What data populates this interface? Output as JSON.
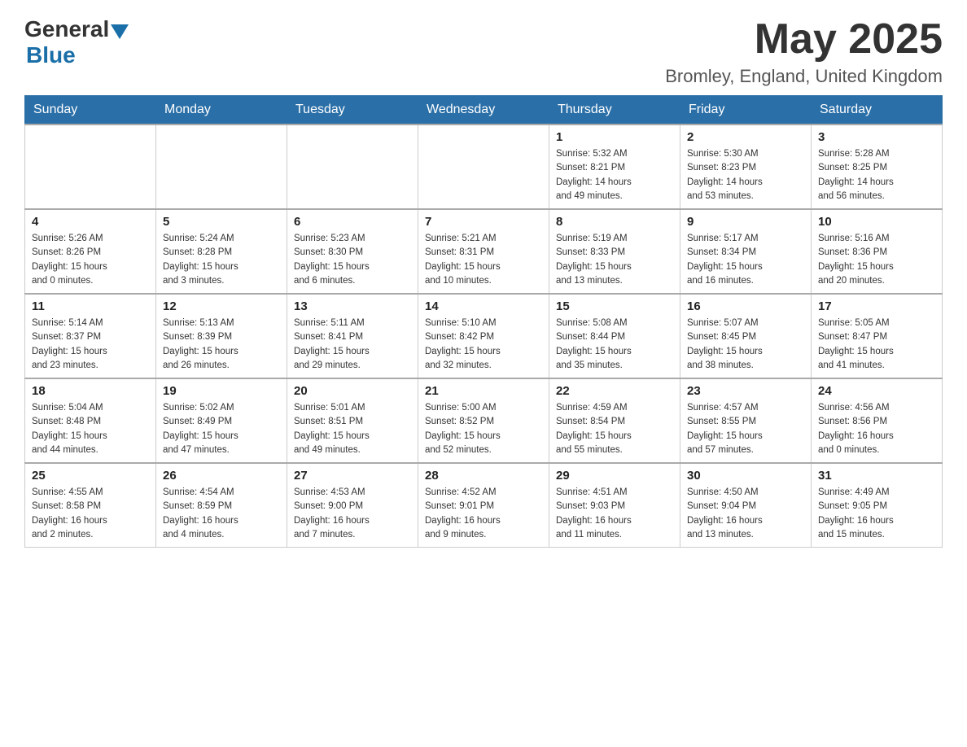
{
  "header": {
    "logo_general": "General",
    "logo_blue": "Blue",
    "month_title": "May 2025",
    "location": "Bromley, England, United Kingdom"
  },
  "days_of_week": [
    "Sunday",
    "Monday",
    "Tuesday",
    "Wednesday",
    "Thursday",
    "Friday",
    "Saturday"
  ],
  "weeks": [
    {
      "days": [
        {
          "number": "",
          "info": ""
        },
        {
          "number": "",
          "info": ""
        },
        {
          "number": "",
          "info": ""
        },
        {
          "number": "",
          "info": ""
        },
        {
          "number": "1",
          "info": "Sunrise: 5:32 AM\nSunset: 8:21 PM\nDaylight: 14 hours\nand 49 minutes."
        },
        {
          "number": "2",
          "info": "Sunrise: 5:30 AM\nSunset: 8:23 PM\nDaylight: 14 hours\nand 53 minutes."
        },
        {
          "number": "3",
          "info": "Sunrise: 5:28 AM\nSunset: 8:25 PM\nDaylight: 14 hours\nand 56 minutes."
        }
      ]
    },
    {
      "days": [
        {
          "number": "4",
          "info": "Sunrise: 5:26 AM\nSunset: 8:26 PM\nDaylight: 15 hours\nand 0 minutes."
        },
        {
          "number": "5",
          "info": "Sunrise: 5:24 AM\nSunset: 8:28 PM\nDaylight: 15 hours\nand 3 minutes."
        },
        {
          "number": "6",
          "info": "Sunrise: 5:23 AM\nSunset: 8:30 PM\nDaylight: 15 hours\nand 6 minutes."
        },
        {
          "number": "7",
          "info": "Sunrise: 5:21 AM\nSunset: 8:31 PM\nDaylight: 15 hours\nand 10 minutes."
        },
        {
          "number": "8",
          "info": "Sunrise: 5:19 AM\nSunset: 8:33 PM\nDaylight: 15 hours\nand 13 minutes."
        },
        {
          "number": "9",
          "info": "Sunrise: 5:17 AM\nSunset: 8:34 PM\nDaylight: 15 hours\nand 16 minutes."
        },
        {
          "number": "10",
          "info": "Sunrise: 5:16 AM\nSunset: 8:36 PM\nDaylight: 15 hours\nand 20 minutes."
        }
      ]
    },
    {
      "days": [
        {
          "number": "11",
          "info": "Sunrise: 5:14 AM\nSunset: 8:37 PM\nDaylight: 15 hours\nand 23 minutes."
        },
        {
          "number": "12",
          "info": "Sunrise: 5:13 AM\nSunset: 8:39 PM\nDaylight: 15 hours\nand 26 minutes."
        },
        {
          "number": "13",
          "info": "Sunrise: 5:11 AM\nSunset: 8:41 PM\nDaylight: 15 hours\nand 29 minutes."
        },
        {
          "number": "14",
          "info": "Sunrise: 5:10 AM\nSunset: 8:42 PM\nDaylight: 15 hours\nand 32 minutes."
        },
        {
          "number": "15",
          "info": "Sunrise: 5:08 AM\nSunset: 8:44 PM\nDaylight: 15 hours\nand 35 minutes."
        },
        {
          "number": "16",
          "info": "Sunrise: 5:07 AM\nSunset: 8:45 PM\nDaylight: 15 hours\nand 38 minutes."
        },
        {
          "number": "17",
          "info": "Sunrise: 5:05 AM\nSunset: 8:47 PM\nDaylight: 15 hours\nand 41 minutes."
        }
      ]
    },
    {
      "days": [
        {
          "number": "18",
          "info": "Sunrise: 5:04 AM\nSunset: 8:48 PM\nDaylight: 15 hours\nand 44 minutes."
        },
        {
          "number": "19",
          "info": "Sunrise: 5:02 AM\nSunset: 8:49 PM\nDaylight: 15 hours\nand 47 minutes."
        },
        {
          "number": "20",
          "info": "Sunrise: 5:01 AM\nSunset: 8:51 PM\nDaylight: 15 hours\nand 49 minutes."
        },
        {
          "number": "21",
          "info": "Sunrise: 5:00 AM\nSunset: 8:52 PM\nDaylight: 15 hours\nand 52 minutes."
        },
        {
          "number": "22",
          "info": "Sunrise: 4:59 AM\nSunset: 8:54 PM\nDaylight: 15 hours\nand 55 minutes."
        },
        {
          "number": "23",
          "info": "Sunrise: 4:57 AM\nSunset: 8:55 PM\nDaylight: 15 hours\nand 57 minutes."
        },
        {
          "number": "24",
          "info": "Sunrise: 4:56 AM\nSunset: 8:56 PM\nDaylight: 16 hours\nand 0 minutes."
        }
      ]
    },
    {
      "days": [
        {
          "number": "25",
          "info": "Sunrise: 4:55 AM\nSunset: 8:58 PM\nDaylight: 16 hours\nand 2 minutes."
        },
        {
          "number": "26",
          "info": "Sunrise: 4:54 AM\nSunset: 8:59 PM\nDaylight: 16 hours\nand 4 minutes."
        },
        {
          "number": "27",
          "info": "Sunrise: 4:53 AM\nSunset: 9:00 PM\nDaylight: 16 hours\nand 7 minutes."
        },
        {
          "number": "28",
          "info": "Sunrise: 4:52 AM\nSunset: 9:01 PM\nDaylight: 16 hours\nand 9 minutes."
        },
        {
          "number": "29",
          "info": "Sunrise: 4:51 AM\nSunset: 9:03 PM\nDaylight: 16 hours\nand 11 minutes."
        },
        {
          "number": "30",
          "info": "Sunrise: 4:50 AM\nSunset: 9:04 PM\nDaylight: 16 hours\nand 13 minutes."
        },
        {
          "number": "31",
          "info": "Sunrise: 4:49 AM\nSunset: 9:05 PM\nDaylight: 16 hours\nand 15 minutes."
        }
      ]
    }
  ]
}
